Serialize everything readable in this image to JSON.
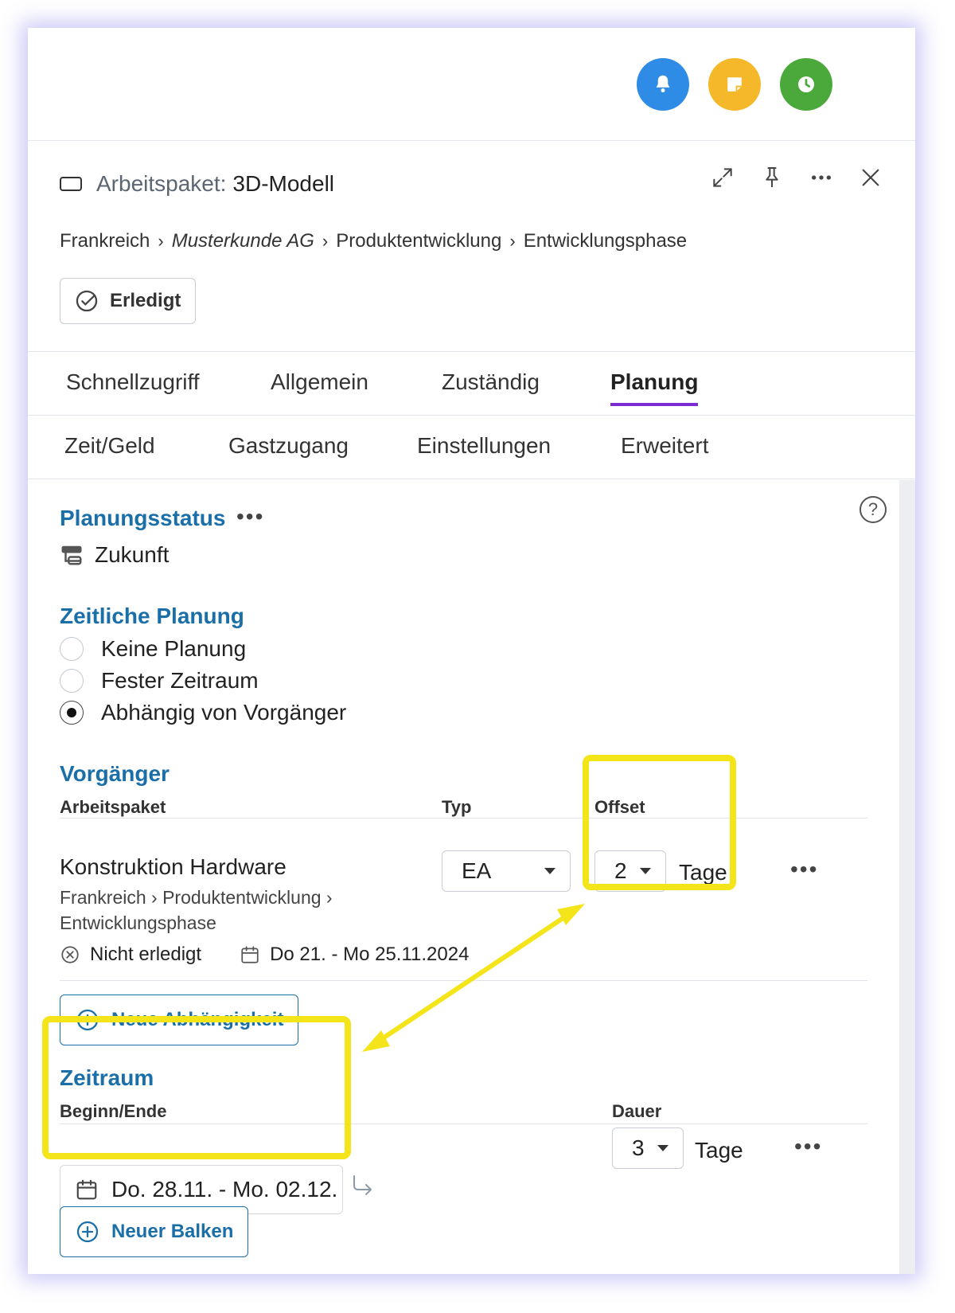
{
  "colors": {
    "accent_blue": "#1a6fa8",
    "tab_underline": "#7a2bd1",
    "highlight": "#f3e51a",
    "bell_circle": "#2f8ce6",
    "note_circle": "#f5b82a",
    "clock_circle": "#4ba83a"
  },
  "topbar": {
    "buttons": [
      {
        "icon": "bell-icon"
      },
      {
        "icon": "sticky-note-icon"
      },
      {
        "icon": "clock-icon"
      }
    ]
  },
  "header": {
    "type_label": "Arbeitspaket:",
    "name": "3D-Modell",
    "icons": [
      "expand-icon",
      "pin-icon",
      "more-icon",
      "close-icon"
    ],
    "breadcrumb": [
      "Frankreich",
      "Musterkunde AG",
      "Produktentwicklung",
      "Entwicklungsphase"
    ],
    "done_label": "Erledigt"
  },
  "tabs_row1": [
    "Schnellzugriff",
    "Allgemein",
    "Zuständig",
    "Planung"
  ],
  "tabs_row2": [
    "Zeit/Geld",
    "Gastzugang",
    "Einstellungen",
    "Erweitert"
  ],
  "active_tab": "Planung",
  "planungsstatus": {
    "title": "Planungsstatus",
    "dots": "•••",
    "value": "Zukunft"
  },
  "zeitliche_planung": {
    "title": "Zeitliche Planung",
    "options": [
      "Keine Planung",
      "Fester Zeitraum",
      "Abhängig von Vorgänger"
    ],
    "selected": "Abhängig von Vorgänger"
  },
  "vorgaenger": {
    "title": "Vorgänger",
    "col_arbeitspaket": "Arbeitspaket",
    "col_typ": "Typ",
    "col_offset": "Offset",
    "name": "Konstruktion Hardware",
    "path_line1": "Frankreich  ›  Produktentwicklung  ›",
    "path_line2": "Entwicklungsphase",
    "status": "Nicht erledigt",
    "dates": "Do 21. - Mo 25.11.2024",
    "typ_value": "EA",
    "offset_value": "2",
    "offset_unit": "Tage",
    "dots": "•••",
    "new_dependency": "Neue Abhängigkeit"
  },
  "zeitraum": {
    "title": "Zeitraum",
    "col_beginn": "Beginn/Ende",
    "col_dauer": "Dauer",
    "date_range": "Do. 28.11. - Mo. 02.12.",
    "duration_value": "3",
    "duration_unit": "Tage",
    "dots": "•••",
    "new_bar": "Neuer Balken"
  },
  "help_symbol": "?"
}
